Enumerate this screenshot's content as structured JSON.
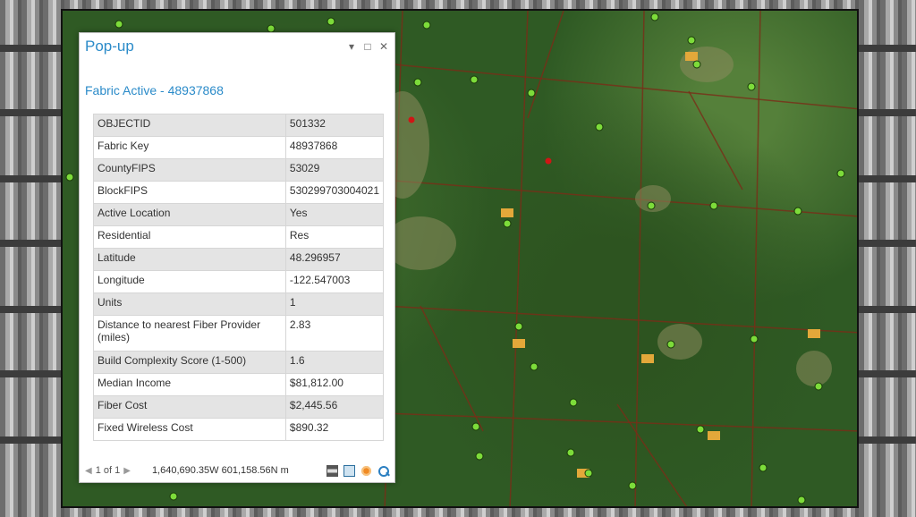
{
  "popup": {
    "title": "Pop-up",
    "subtitle": "Fabric Active - 48937868",
    "window_buttons": [
      "pin-icon",
      "maximize-icon",
      "close-icon"
    ],
    "rows": [
      {
        "key": "OBJECTID",
        "value": "501332"
      },
      {
        "key": "Fabric Key",
        "value": "48937868"
      },
      {
        "key": "CountyFIPS",
        "value": "53029"
      },
      {
        "key": "BlockFIPS",
        "value": "530299703004021"
      },
      {
        "key": "Active Location",
        "value": "Yes"
      },
      {
        "key": "Residential",
        "value": "Res"
      },
      {
        "key": "Latitude",
        "value": "48.296957"
      },
      {
        "key": "Longitude",
        "value": "-122.547003"
      },
      {
        "key": "Units",
        "value": "1"
      },
      {
        "key": "Distance to nearest Fiber Provider (miles)",
        "value": "2.83"
      },
      {
        "key": "Build Complexity Score (1-500)",
        "value": "1.6"
      },
      {
        "key": "Median Income",
        "value": "$81,812.00"
      },
      {
        "key": "Fiber Cost",
        "value": "$2,445.56"
      },
      {
        "key": "Fixed Wireless Cost",
        "value": "$890.32"
      }
    ],
    "footer": {
      "pager": "1 of 1",
      "coordinates": "1,640,690.35W 601,158.56N m",
      "tools": [
        "print-icon",
        "export-icon",
        "flash-icon",
        "zoom-to-icon"
      ]
    }
  },
  "map": {
    "point_color_active": "#7ddc3a",
    "point_color_inactive": "#d01515",
    "parcel_line_color": "#7a2d18"
  }
}
